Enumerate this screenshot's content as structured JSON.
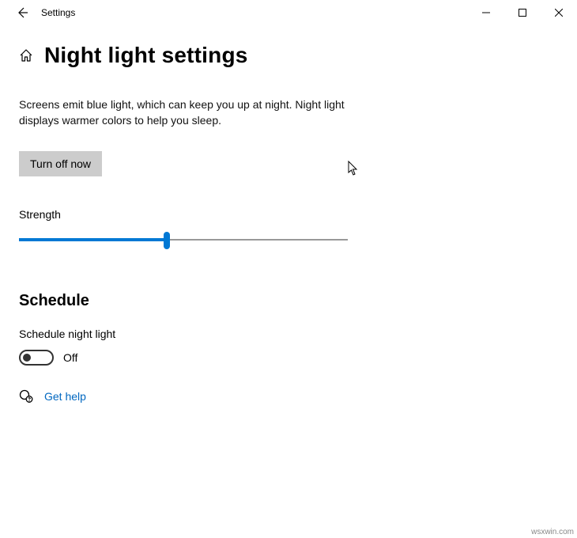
{
  "window": {
    "title": "Settings"
  },
  "page": {
    "title": "Night light settings",
    "description": "Screens emit blue light, which can keep you up at night. Night light displays warmer colors to help you sleep.",
    "turn_off_button": "Turn off now",
    "strength_label": "Strength",
    "strength_value_percent": 45
  },
  "schedule": {
    "heading": "Schedule",
    "toggle_label": "Schedule night light",
    "toggle_state": "Off",
    "toggle_on": false
  },
  "help": {
    "label": "Get help"
  },
  "watermark": "wsxwin.com"
}
